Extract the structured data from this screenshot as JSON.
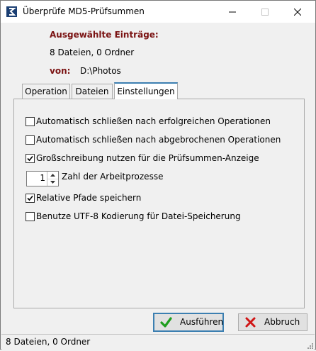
{
  "window": {
    "title": "Überprüfe MD5-Prüfsummen",
    "controls": {
      "minimize": "—",
      "maximize": "☐",
      "close": "✕"
    }
  },
  "selection": {
    "heading": "Ausgewählte Einträge:",
    "summary": "8 Dateien, 0 Ordner",
    "from_label": "von:",
    "from_path": "D:\\Photos"
  },
  "tabs": [
    {
      "label": "Operation",
      "active": false
    },
    {
      "label": "Dateien",
      "active": false
    },
    {
      "label": "Einstellungen",
      "active": true
    }
  ],
  "settings": {
    "options": [
      {
        "label": "Automatisch schließen nach erfolgreichen Operationen",
        "checked": false
      },
      {
        "label": "Automatisch schließen nach abgebrochenen Operationen",
        "checked": false
      },
      {
        "label": "Großschreibung nutzen für die Prüfsummen-Anzeige",
        "checked": true
      }
    ],
    "worker_count": {
      "value": "1",
      "label": "Zahl der Arbeitprozesse"
    },
    "options2": [
      {
        "label": "Relative Pfade speichern",
        "checked": true
      },
      {
        "label": "Benutze UTF-8 Kodierung für Datei-Speicherung",
        "checked": false
      }
    ]
  },
  "buttons": {
    "run": "Ausführen",
    "cancel": "Abbruch"
  },
  "status": {
    "text": "8 Dateien, 0 Ordner"
  },
  "colors": {
    "accent": "#3c7fb1",
    "heading": "#7a1212",
    "run_icon": "#1e9e1e",
    "cancel_icon": "#d01515"
  }
}
